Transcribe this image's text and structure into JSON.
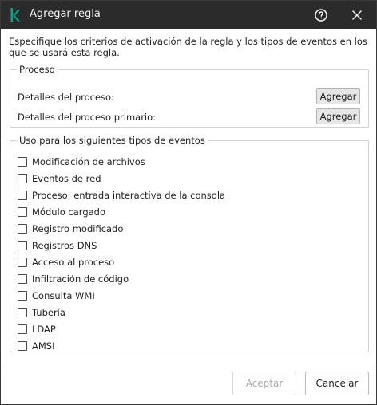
{
  "window": {
    "title": "Agregar regla",
    "logo_icon": "kaspersky-k-logo",
    "brand_color": "#00a88e",
    "help_icon": "question-circle-icon",
    "close_icon": "close-icon"
  },
  "description": "Especifique los criterios de activación de la regla y los tipos de eventos en los que se usará esta regla.",
  "proceso": {
    "legend": "Proceso",
    "rows": [
      {
        "label": "Detalles del proceso:",
        "button": "Agregar"
      },
      {
        "label": "Detalles del proceso primario:",
        "button": "Agregar"
      }
    ]
  },
  "eventos": {
    "legend": "Uso para los siguientes tipos de eventos",
    "items": [
      {
        "label": "Modificación de archivos",
        "checked": false
      },
      {
        "label": "Eventos de red",
        "checked": false
      },
      {
        "label": "Proceso: entrada interactiva de la consola",
        "checked": false
      },
      {
        "label": "Módulo cargado",
        "checked": false
      },
      {
        "label": "Registro modificado",
        "checked": false
      },
      {
        "label": "Registros DNS",
        "checked": false
      },
      {
        "label": "Acceso al proceso",
        "checked": false
      },
      {
        "label": "Infiltración de código",
        "checked": false
      },
      {
        "label": "Consulta WMI",
        "checked": false
      },
      {
        "label": "Tubería",
        "checked": false
      },
      {
        "label": "LDAP",
        "checked": false
      },
      {
        "label": "AMSI",
        "checked": false
      }
    ]
  },
  "footer": {
    "accept_label": "Aceptar",
    "accept_enabled": false,
    "cancel_label": "Cancelar"
  }
}
